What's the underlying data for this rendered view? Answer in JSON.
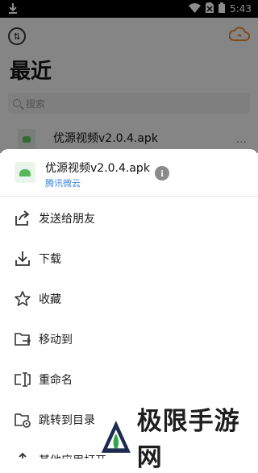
{
  "status_bar": {
    "time": "5:43"
  },
  "screen": {
    "title": "最近",
    "search_placeholder": "搜索",
    "list_item": {
      "name": "优源视频v2.0.4.apk",
      "more": "···"
    }
  },
  "sheet": {
    "file_name": "优源视频v2.0.4.apk",
    "file_source": "腾讯微云",
    "info_glyph": "i",
    "actions": [
      {
        "label": "发送给朋友",
        "icon": "share-icon"
      },
      {
        "label": "下载",
        "icon": "download-icon"
      },
      {
        "label": "收藏",
        "icon": "star-icon"
      },
      {
        "label": "移动到",
        "icon": "move-icon"
      },
      {
        "label": "重命名",
        "icon": "rename-icon"
      },
      {
        "label": "跳转到目录",
        "icon": "folder-jump-icon"
      },
      {
        "label": "其他应用打开",
        "icon": "open-with-icon"
      }
    ]
  },
  "watermark": {
    "text": "极限手游网"
  },
  "colors": {
    "accent_blue": "#3a86d9",
    "apk_green": "#59b85a",
    "cloud_orange": "#e0892a"
  }
}
